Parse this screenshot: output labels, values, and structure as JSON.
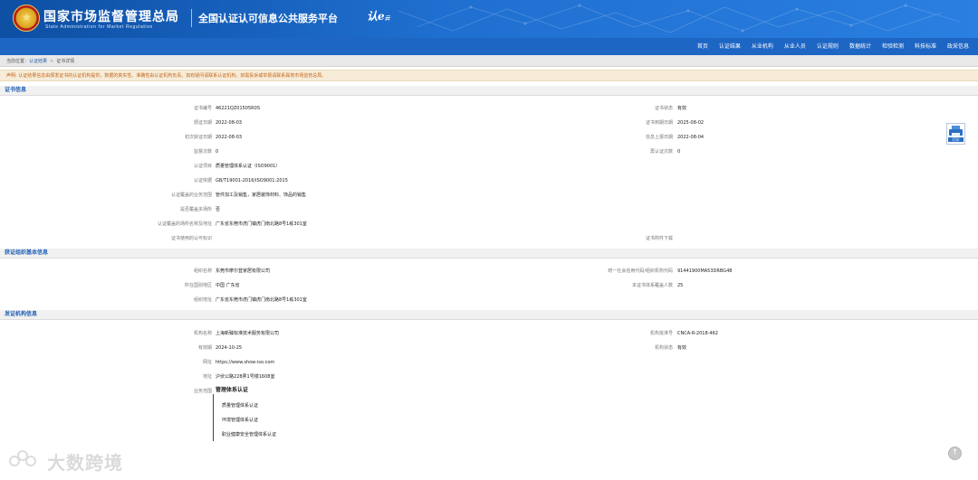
{
  "header": {
    "org_name_cn": "国家市场监督管理总局",
    "org_name_en": "State Administration  for  Market Regulation",
    "platform_title": "全国认证认可信息公共服务平台",
    "platform_logo_main": "认e",
    "platform_logo_sub": "云"
  },
  "nav": {
    "items": [
      "首页",
      "认证结果",
      "从业机构",
      "从业人员",
      "认证规则",
      "数据统计",
      "检验检测",
      "科技标准",
      "政采信息"
    ]
  },
  "breadcrumb": {
    "prefix": "当前位置：",
    "items": [
      "认证结果",
      "证书详情"
    ]
  },
  "disclaimer": "声明: 认证结果信息由颁发证书的认证机构提供，数据的真实性、准确性由认证机构负责。如有疑问请联系认证机构。如需投诉或举报请联系属地市场监管总局。",
  "sections": {
    "cert_info": "证书信息",
    "org_info": "获证组织基本信息",
    "issuer_info": "发证机构信息"
  },
  "cert": {
    "number_label": "证书编号",
    "number": "46221QZ01505R0S",
    "status_label": "证书状态",
    "status": "有效",
    "issue_date_label": "颁证日期",
    "issue_date": "2022-08-03",
    "expiry_label": "证书到期日期",
    "expiry": "2025-08-02",
    "first_issue_label": "初次获证日期",
    "first_issue": "2022-08-03",
    "reported_label": "信息上报日期",
    "reported": "2022-08-04",
    "surveillance_label": "监督次数",
    "surveillance": "0",
    "recert_label": "再认证次数",
    "recert": "0",
    "project_label": "认证项目",
    "project": "质量管理体系认证（ISO9001）",
    "basis_label": "认证依据",
    "basis": "GB/T19001-2016/ISO9001:2015",
    "scope_label": "认证覆盖的业务范围",
    "scope": "管件加工及销售，家居装饰材料、饰品的销售",
    "multi_site_label": "是否覆盖多场所",
    "multi_site": "否",
    "address_label": "认证覆盖的场所名称及地址",
    "address": "广东省东莞市虎门镇虎门南北路8号1栋301室",
    "mark_label": "证书使用的认可标识",
    "mark": "",
    "attachment_label": "证书附件下载",
    "attachment": ""
  },
  "org": {
    "name_label": "组织名称",
    "name": "东莞市摩尔登家居有限公司",
    "credit_code_label": "统一社会信用代码/组织机构代码",
    "credit_code": "91441900MA53DRBG48",
    "region_label": "所在国别地区",
    "region": "中国  广东省",
    "staff_label": "本证书体系覆盖人数",
    "staff": "25",
    "address_label": "组织地址",
    "address": "广东省东莞市虎门镇虎门南北路8号1栋301室"
  },
  "issuer": {
    "name_label": "机构名称",
    "name": "上海新臻标准技术服务有限公司",
    "approval_label": "机构批准号",
    "approval": "CNCA-R-2018-462",
    "valid_label": "有效期",
    "valid": "2024-10-25",
    "status_label": "机构状态",
    "status": "有效",
    "website_label": "网址",
    "website": "https://www.show-iso.com",
    "address_label": "地址",
    "address": "沪伏公路228弄1号楼1608室",
    "scope_label": "业务范围",
    "scope_title": "管理体系认证",
    "scope_items": [
      "质量管理体系认证",
      "环境管理体系认证",
      "职业健康安全管理体系认证"
    ]
  },
  "actions": {
    "print": "打印",
    "scroll_top": "↑"
  },
  "watermark": "大数跨境",
  "colors": {
    "header_blue": "#1e66c4",
    "section_title": "#2060b6",
    "disclaimer_text": "#c2661c"
  }
}
